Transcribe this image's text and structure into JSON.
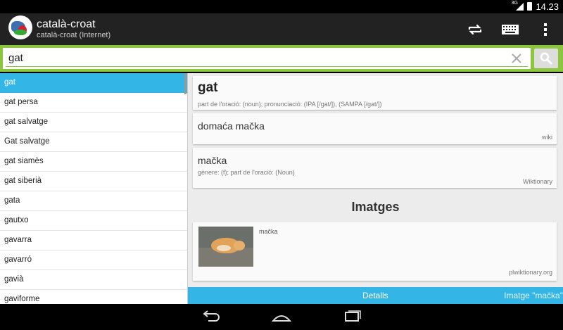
{
  "status_bar": {
    "network": "3G",
    "time": "14.23"
  },
  "action_bar": {
    "title": "català-croat",
    "subtitle": "català-croat (Internet)"
  },
  "search": {
    "value": "gat"
  },
  "word_list": [
    {
      "label": "gat",
      "selected": true
    },
    {
      "label": "gat persa"
    },
    {
      "label": "gat salvatge"
    },
    {
      "label": "Gat salvatge"
    },
    {
      "label": "gat siamès"
    },
    {
      "label": "gat siberià"
    },
    {
      "label": "gata"
    },
    {
      "label": "gautxo"
    },
    {
      "label": "gavarra"
    },
    {
      "label": "gavarró"
    },
    {
      "label": "gavià"
    },
    {
      "label": "gaviforme"
    }
  ],
  "entry": {
    "headword": "gat",
    "meta": "part de l'oració: (noun); pronunciació: (IPA [/gat/]), (SAMPA [/gat/])",
    "translations": [
      {
        "word": "domaća mačka",
        "meta": "",
        "source": "wiki"
      },
      {
        "word": "mačka",
        "meta": "gènere: (f); part de l'oració: (Noun)",
        "source": "Wiktionary"
      }
    ]
  },
  "images": {
    "heading": "Imatges",
    "item": {
      "caption": "mačka",
      "source": "plwiktionary.org"
    }
  },
  "bottom_bar": {
    "details_label": "Detalls",
    "image_label": "Imatge \"mačka\""
  },
  "colors": {
    "accent_blue": "#33b5e5",
    "search_green": "#8cc63f",
    "action_bar": "#222222"
  }
}
